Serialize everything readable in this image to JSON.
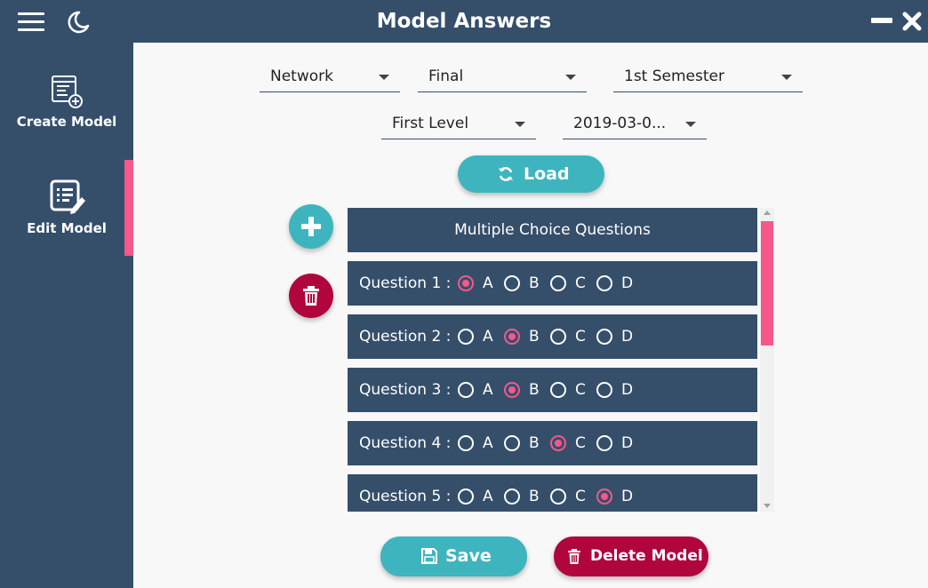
{
  "window": {
    "title": "Model Answers",
    "icons": {
      "menu": "hamburger-icon",
      "theme": "moon-icon",
      "minimize": "minimize-icon",
      "close": "close-icon"
    }
  },
  "sidebar": {
    "items": [
      {
        "label": "Create Model",
        "icon": "create-model-icon",
        "active": false
      },
      {
        "label": "Edit Model",
        "icon": "edit-model-icon",
        "active": true
      }
    ]
  },
  "filters": {
    "department": "Network",
    "exam_type": "Final",
    "semester": "1st Semester",
    "level": "First Level",
    "date": "2019-03-0..."
  },
  "load_button": {
    "label": "Load",
    "icon": "refresh-icon"
  },
  "add_button": {
    "icon": "plus-icon"
  },
  "delete_question_button": {
    "icon": "trash-icon"
  },
  "mcq": {
    "header": "Multiple Choice Questions",
    "options": [
      "A",
      "B",
      "C",
      "D"
    ],
    "questions": [
      {
        "label": "Question 1 :",
        "selected": "A"
      },
      {
        "label": "Question 2 :",
        "selected": "B"
      },
      {
        "label": "Question 3 :",
        "selected": "B"
      },
      {
        "label": "Question 4 :",
        "selected": "C"
      },
      {
        "label": "Question 5 :",
        "selected": "D"
      }
    ]
  },
  "footer": {
    "save_label": "Save",
    "delete_label": "Delete Model"
  },
  "colors": {
    "primary": "#354f6b",
    "accent": "#f55889",
    "teal": "#3eb5be",
    "danger": "#b0063d",
    "background": "#f8f8f8"
  }
}
